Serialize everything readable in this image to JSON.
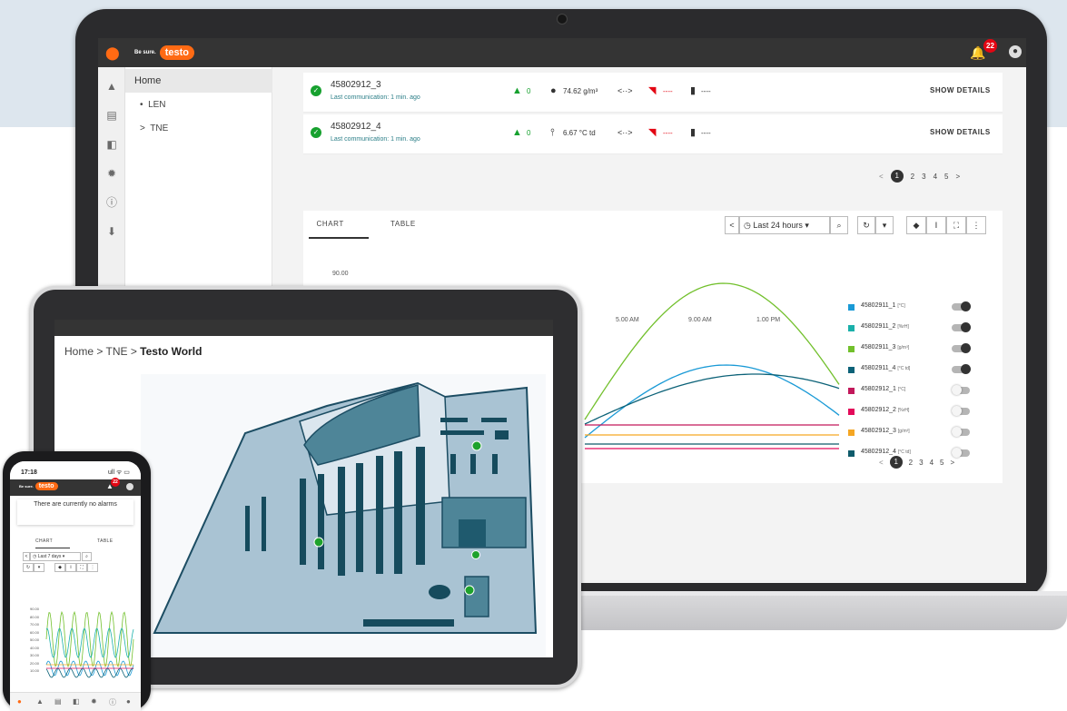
{
  "laptop": {
    "brand": {
      "tagline": "Be sure.",
      "name": "testo"
    },
    "notifications_count": "22",
    "nav_tree": {
      "home": "Home",
      "items": [
        {
          "bullet": "•",
          "label": "LEN"
        },
        {
          "bullet": ">",
          "label": "TNE"
        }
      ]
    },
    "devices": [
      {
        "name": "45802912_3",
        "last_comm": "Last communication: 1 min. ago",
        "alarm_count": "0",
        "reading": "74.62 g/m³",
        "signal": "----",
        "battery": "----",
        "action": "SHOW DETAILS"
      },
      {
        "name": "45802912_4",
        "last_comm": "Last communication: 1 min. ago",
        "alarm_count": "0",
        "reading": "6.67 °C td",
        "signal": "----",
        "battery": "----",
        "action": "SHOW DETAILS"
      }
    ],
    "pagination": {
      "prev": "<",
      "pages": [
        "1",
        "2",
        "3",
        "4",
        "5"
      ],
      "current": "1",
      "next": ">"
    },
    "tabs": [
      "CHART",
      "TABLE"
    ],
    "toolbar": {
      "back": "<",
      "range": "Last 24 hours",
      "dropdown": "▾"
    },
    "legend_pagination": {
      "prev": "<",
      "pages": [
        "1",
        "2",
        "3",
        "4",
        "5"
      ],
      "current": "1",
      "next": ">"
    }
  },
  "chart_data": {
    "type": "line",
    "x_ticks": [
      "5.00 AM",
      "9.00 AM",
      "1.00 PM"
    ],
    "y_ticks": [
      "90.00"
    ],
    "series": [
      {
        "name": "45802911_1",
        "unit": "[°C]",
        "color": "#1a9ad6",
        "enabled": true
      },
      {
        "name": "45802911_2",
        "unit": "[%rH]",
        "color": "#1ab0aa",
        "enabled": true
      },
      {
        "name": "45802911_3",
        "unit": "[g/m³]",
        "color": "#72c02c",
        "enabled": true
      },
      {
        "name": "45802911_4",
        "unit": "[°C td]",
        "color": "#0c6278",
        "enabled": true
      },
      {
        "name": "45802912_1",
        "unit": "[°C]",
        "color": "#c2185b",
        "enabled": false
      },
      {
        "name": "45802912_2",
        "unit": "[%rH]",
        "color": "#e30a5a",
        "enabled": false
      },
      {
        "name": "45802912_3",
        "unit": "[g/m³]",
        "color": "#f5a623",
        "enabled": false
      },
      {
        "name": "45802912_4",
        "unit": "[°C td]",
        "color": "#0f5b6b",
        "enabled": false
      }
    ]
  },
  "tablet": {
    "breadcrumb": {
      "home": "Home",
      "sep": " > ",
      "level1": "TNE",
      "current": "Testo World"
    }
  },
  "phone": {
    "time": "17:18",
    "status": "ull ᯤ ▭",
    "brand": {
      "tagline": "Be sure.",
      "name": "testo"
    },
    "notifications_count": "22",
    "alarm_banner": "There are currently no alarms",
    "tabs": [
      "CHART",
      "TABLE"
    ],
    "range": "Last 7 days",
    "y_ticks": [
      "90.00",
      "80.00",
      "70.00",
      "60.00",
      "50.00",
      "40.00",
      "30.00",
      "20.00",
      "10.00"
    ]
  }
}
